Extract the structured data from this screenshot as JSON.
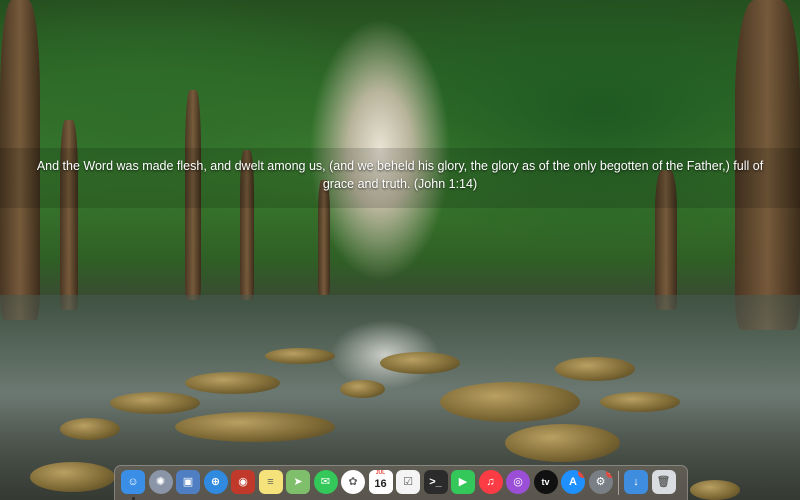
{
  "wallpaper": {
    "caption_line1": "And the Word was made flesh, and dwelt among us, (and we beheld his glory, the glory as of the only begotten of the Father,) full of",
    "caption_line2": "grace and truth. (John 1:14)"
  },
  "dock": {
    "apps": [
      {
        "name": "Finder",
        "icon": "finder-icon",
        "color": "#3a8ee6",
        "running": true
      },
      {
        "name": "Launchpad",
        "icon": "launchpad-icon",
        "color": "#8a96a8"
      },
      {
        "name": "Preview",
        "icon": "preview-icon",
        "color": "#4f7fc2"
      },
      {
        "name": "Safari",
        "icon": "safari-icon",
        "color": "#2f8ae0"
      },
      {
        "name": "Photo Booth",
        "icon": "photo-booth-icon",
        "color": "#c0392b"
      },
      {
        "name": "Notes",
        "icon": "notes-icon",
        "color": "#f5e27a"
      },
      {
        "name": "Maps",
        "icon": "maps-icon",
        "color": "#7fbf6b"
      },
      {
        "name": "Messages",
        "icon": "messages-icon",
        "color": "#34c759"
      },
      {
        "name": "Photos",
        "icon": "photos-icon",
        "color": "#ffffff"
      },
      {
        "name": "Calendar",
        "icon": "calendar-icon",
        "color": "#ffffff",
        "month": "JUL",
        "day": "16"
      },
      {
        "name": "Reminders",
        "icon": "reminders-icon",
        "color": "#f4f4f4"
      },
      {
        "name": "Terminal",
        "icon": "terminal-icon",
        "color": "#2b2b2b"
      },
      {
        "name": "FaceTime",
        "icon": "facetime-icon",
        "color": "#34c759"
      },
      {
        "name": "Music",
        "icon": "music-icon",
        "color": "#fc3c44"
      },
      {
        "name": "Podcasts",
        "icon": "podcasts-icon",
        "color": "#9b4fd6"
      },
      {
        "name": "TV",
        "icon": "apple-tv-icon",
        "color": "#111111",
        "label": "tv"
      },
      {
        "name": "App Store",
        "icon": "app-store-icon",
        "color": "#1e90ff",
        "badge": "8"
      },
      {
        "name": "System Preferences",
        "icon": "system-preferences-icon",
        "color": "#7a7f86",
        "badge": "1"
      }
    ],
    "others": [
      {
        "name": "Downloads",
        "icon": "downloads-folder-icon",
        "color": "#3f8ddf"
      },
      {
        "name": "Trash",
        "icon": "trash-icon",
        "color": "#d9dde2"
      }
    ]
  }
}
